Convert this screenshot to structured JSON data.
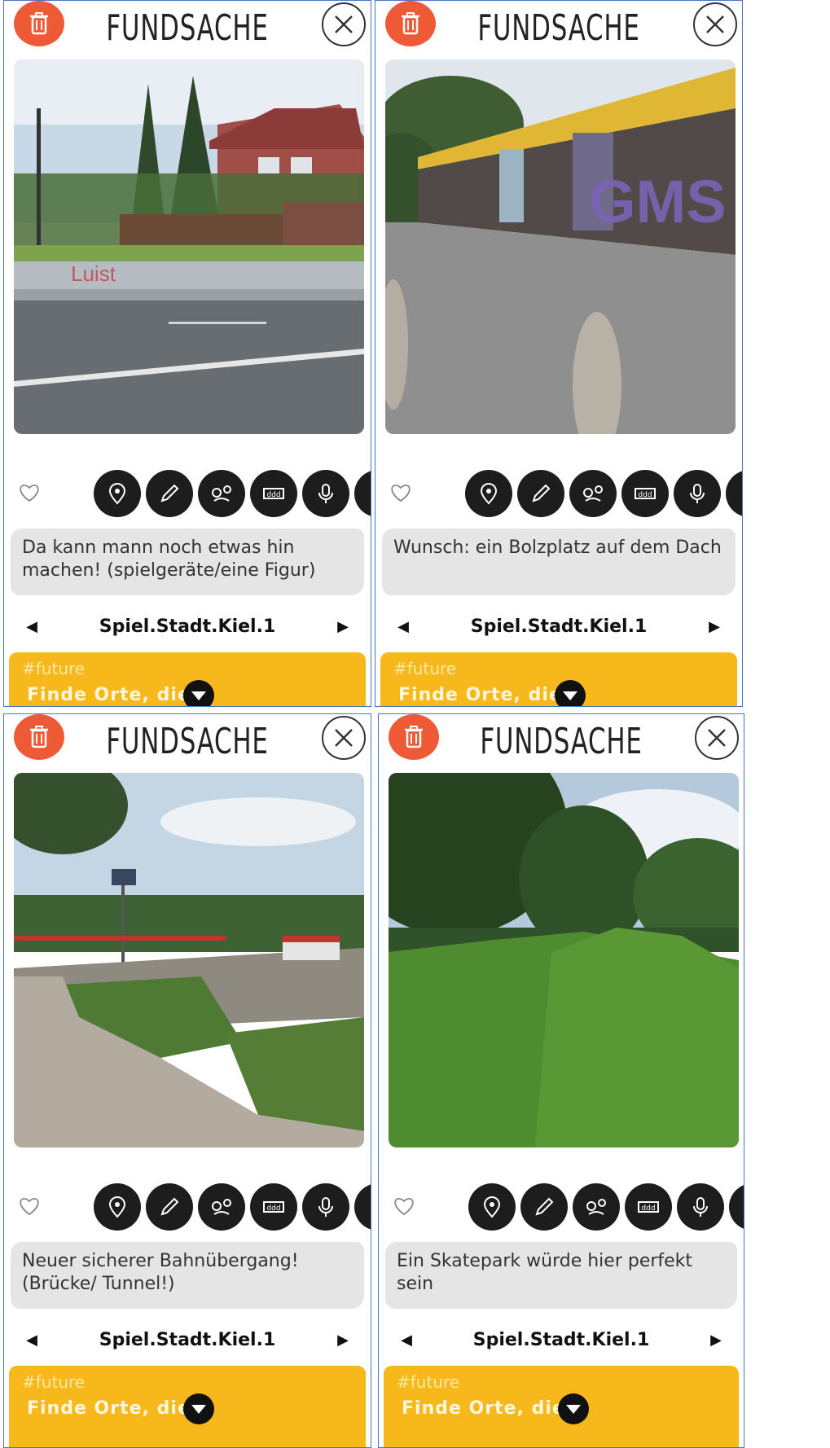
{
  "app": {
    "title": "FUNDSACHE"
  },
  "tools": [
    "location-pin",
    "pencil",
    "route",
    "ticket",
    "microphone",
    "play"
  ],
  "panels": [
    {
      "caption": "Da kann mann noch etwas hin machen! (spielgeräte/eine Figur)",
      "nav_title": "Spiel.Stadt.Kiel.1",
      "tag": "#future",
      "finde": "Finde Orte, die"
    },
    {
      "caption": "Wunsch: ein Bolzplatz auf dem Dach",
      "nav_title": "Spiel.Stadt.Kiel.1",
      "tag": "#future",
      "finde": "Finde Orte, die"
    },
    {
      "caption": "Neuer sicherer Bahnübergang! (Brücke/ Tunnel!)",
      "nav_title": "Spiel.Stadt.Kiel.1",
      "tag": "#future",
      "finde": "Finde Orte, die"
    },
    {
      "caption": "Ein Skatepark würde hier perfekt sein",
      "nav_title": "Spiel.Stadt.Kiel.1",
      "tag": "#future",
      "finde": "Finde Orte, die"
    }
  ],
  "colors": {
    "trash": "#ef5a36",
    "banner": "#f7b81c",
    "tool": "#1d1d1d",
    "caption_bg": "#e5e5e5"
  }
}
